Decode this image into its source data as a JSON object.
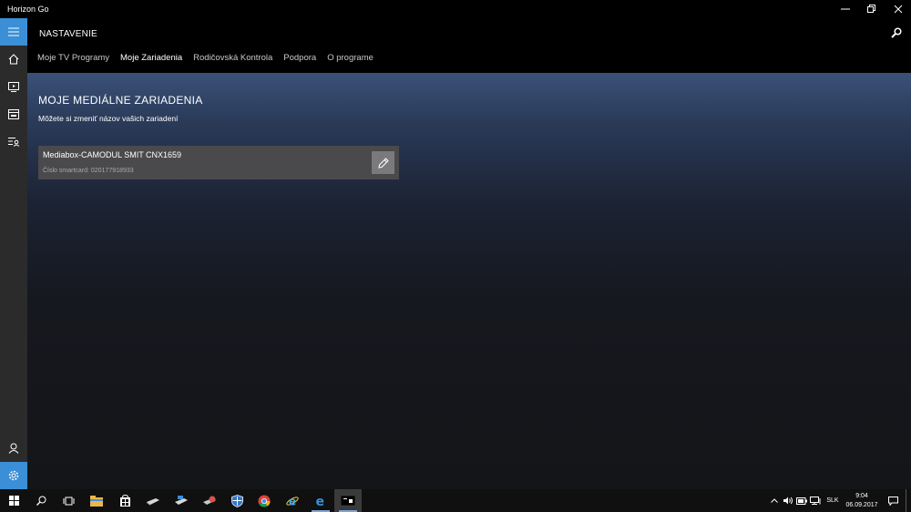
{
  "window": {
    "title": "Horizon Go"
  },
  "header": {
    "title": "NASTAVENIE",
    "tabs": [
      {
        "label": "Moje TV Programy",
        "active": false
      },
      {
        "label": "Moje Zariadenia",
        "active": true
      },
      {
        "label": "Rodičovská Kontrola",
        "active": false
      },
      {
        "label": "Podpora",
        "active": false
      },
      {
        "label": "O programe",
        "active": false
      }
    ]
  },
  "sidebar": {
    "items": [
      "menu-icon",
      "home-icon",
      "tv-icon",
      "guide-icon",
      "recordings-icon",
      "user-icon",
      "settings-icon"
    ]
  },
  "content": {
    "section_title": "MOJE MEDIÁLNE ZARIADENIA",
    "section_subtitle": "Môžete si zmeniť názov vašich zariadení",
    "device": {
      "name": "Mediabox-CAMODUL SMIT CNX1659",
      "smartcard_label": "Číslo smartcard: 020177918933"
    }
  },
  "taskbar": {
    "language": "SLK",
    "time": "9:04",
    "date": "06.09.2017"
  },
  "colors": {
    "accent": "#3a8fd6",
    "card": "#4a4a4c",
    "edit_button": "#7a7a7c"
  }
}
